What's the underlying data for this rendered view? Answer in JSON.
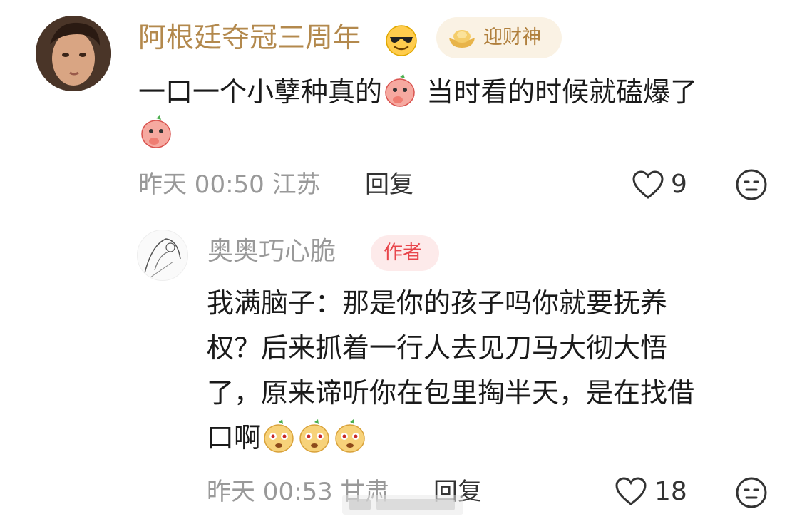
{
  "comment": {
    "username": "阿根廷夺冠三周年",
    "username_emoji": "sunglasses-emoji",
    "badge_label": "迎财神",
    "text_line1": "一口一个小孽种真的",
    "text_line1b": "当时看的时候就磕爆了",
    "time": "昨天 00:50",
    "location": "江苏",
    "reply_label": "回复",
    "like_count": "9"
  },
  "reply": {
    "username": "奥奥巧心脆",
    "badge_label": "作者",
    "text_lines": [
      "我满脑子：那是你的孩子吗你就要抚养",
      "权？后来抓着一行人去见刀马大彻大悟",
      "了，原来谛听你在包里掏半天，是在找借",
      "口啊"
    ],
    "time": "昨天 00:53",
    "location": "甘肃",
    "reply_label": "回复",
    "like_count": "18"
  },
  "colors": {
    "vip_name": "#b3894d",
    "author_badge": "#e8454b",
    "meta": "#999999"
  }
}
